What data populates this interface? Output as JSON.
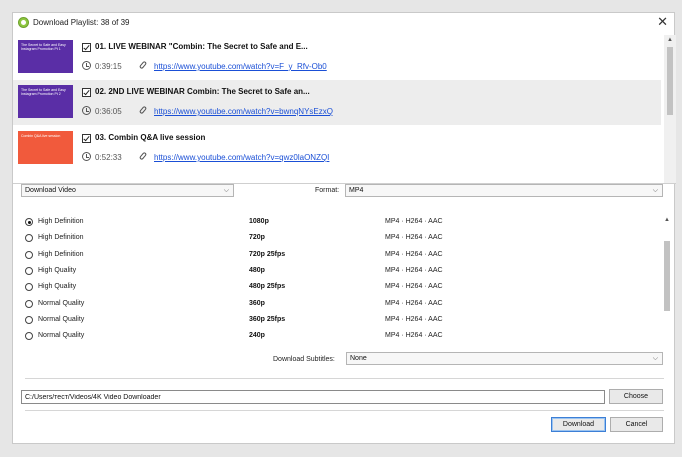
{
  "window": {
    "title": "Download Playlist: 38 of 39",
    "close_glyph": "✕"
  },
  "playlist": [
    {
      "title": "01. LIVE WEBINAR \"Combin: The Secret to Safe and E...",
      "duration": "0:39:15",
      "url": "https://www.youtube.com/watch?v=F_y_Rfv-Ob0",
      "thumb_text": "The Secret to Safe and Easy Instagram Promotion Pt 1",
      "thumb_color": "#5a2ea6"
    },
    {
      "title": "02. 2ND LIVE WEBINAR Combin: The Secret to Safe an...",
      "duration": "0:36:05",
      "url": "https://www.youtube.com/watch?v=bwnqNYsEzxQ",
      "thumb_text": "The Secret to Safe and Easy Instagram Promotion Pt 2",
      "thumb_color": "#5a2ea6"
    },
    {
      "title": "03. Combin Q&A live session",
      "duration": "0:52:33",
      "url": "https://www.youtube.com/watch?v=qwz0laONZQI",
      "thumb_text": "Combin Q&A live session",
      "thumb_color": "#f15a3c"
    }
  ],
  "type_select": {
    "value": "Download Video"
  },
  "format": {
    "label": "Format:",
    "value": "MP4"
  },
  "qualities": [
    {
      "name": "High Definition",
      "res": "1080p",
      "fmt": "MP4 · H264 · AAC",
      "selected": true
    },
    {
      "name": "High Definition",
      "res": "720p",
      "fmt": "MP4 · H264 · AAC"
    },
    {
      "name": "High Definition",
      "res": "720p 25fps",
      "fmt": "MP4 · H264 · AAC"
    },
    {
      "name": "High Quality",
      "res": "480p",
      "fmt": "MP4 · H264 · AAC"
    },
    {
      "name": "High Quality",
      "res": "480p 25fps",
      "fmt": "MP4 · H264 · AAC"
    },
    {
      "name": "Normal Quality",
      "res": "360p",
      "fmt": "MP4 · H264 · AAC"
    },
    {
      "name": "Normal Quality",
      "res": "360p 25fps",
      "fmt": "MP4 · H264 · AAC"
    },
    {
      "name": "Normal Quality",
      "res": "240p",
      "fmt": "MP4 · H264 · AAC"
    }
  ],
  "subtitles": {
    "label": "Download Subtitles:",
    "value": "None"
  },
  "path": {
    "value": "C:/Users/тест/Videos/4K Video Downloader"
  },
  "buttons": {
    "choose": "Choose",
    "download": "Download",
    "cancel": "Cancel"
  },
  "glyphs": {
    "chevron_down": "⌵",
    "scroll_up": "▲"
  }
}
